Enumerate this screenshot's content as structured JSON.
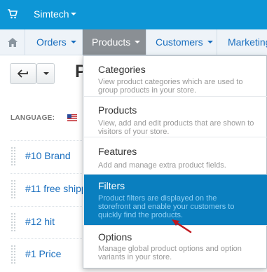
{
  "topbar": {
    "store_name": "Simtech",
    "bg_color": "#0d96d6"
  },
  "nav": {
    "items": [
      {
        "label": "Orders"
      },
      {
        "label": "Products",
        "active": true
      },
      {
        "label": "Customers"
      },
      {
        "label": "Marketing"
      }
    ]
  },
  "page": {
    "title_visible": "P",
    "language_label": "LANGUAGE:",
    "rows": [
      {
        "label": "#10 Brand"
      },
      {
        "label": "#11 free shipp"
      },
      {
        "label": "#12 hit"
      },
      {
        "label": "#1 Price"
      }
    ]
  },
  "products_menu": {
    "items": [
      {
        "title": "Categories",
        "desc": "View product categories which are used to group products in your store."
      },
      {
        "title": "Products",
        "desc": "View, add and edit products that are shown to visitors of your store."
      },
      {
        "title": "Features",
        "desc": "Add and manage extra product fields."
      },
      {
        "title": "Filters",
        "desc": "Product filters are displayed on the storefront and enable your customers to quickly find the products.",
        "highlighted": true
      },
      {
        "title": "Options",
        "desc": "Manage global product options and option variants in your store."
      }
    ]
  },
  "colors": {
    "accent": "#0d96d6",
    "link": "#1a6fbf",
    "highlight": "#0a7fbf",
    "annotation": "#c0181f"
  }
}
